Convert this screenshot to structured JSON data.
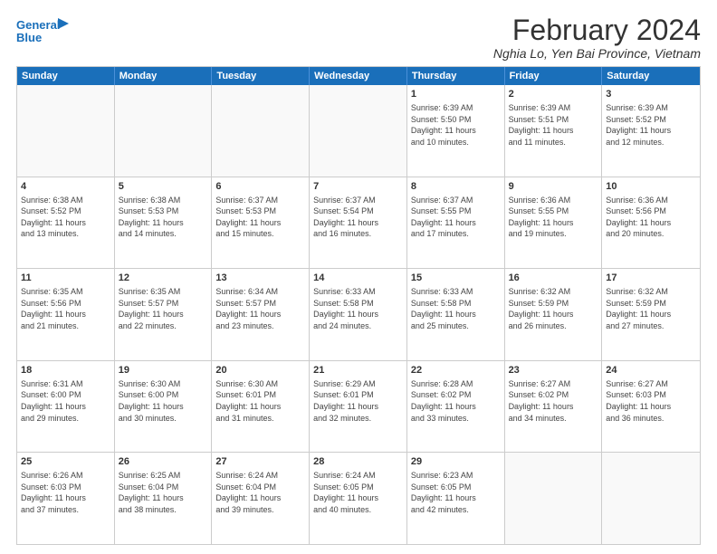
{
  "logo": {
    "line1": "General",
    "line2": "Blue",
    "icon_color": "#1a6fba"
  },
  "title": "February 2024",
  "location": "Nghia Lo, Yen Bai Province, Vietnam",
  "header_days": [
    "Sunday",
    "Monday",
    "Tuesday",
    "Wednesday",
    "Thursday",
    "Friday",
    "Saturday"
  ],
  "rows": [
    [
      {
        "day": "",
        "info": ""
      },
      {
        "day": "",
        "info": ""
      },
      {
        "day": "",
        "info": ""
      },
      {
        "day": "",
        "info": ""
      },
      {
        "day": "1",
        "info": "Sunrise: 6:39 AM\nSunset: 5:50 PM\nDaylight: 11 hours\nand 10 minutes."
      },
      {
        "day": "2",
        "info": "Sunrise: 6:39 AM\nSunset: 5:51 PM\nDaylight: 11 hours\nand 11 minutes."
      },
      {
        "day": "3",
        "info": "Sunrise: 6:39 AM\nSunset: 5:52 PM\nDaylight: 11 hours\nand 12 minutes."
      }
    ],
    [
      {
        "day": "4",
        "info": "Sunrise: 6:38 AM\nSunset: 5:52 PM\nDaylight: 11 hours\nand 13 minutes."
      },
      {
        "day": "5",
        "info": "Sunrise: 6:38 AM\nSunset: 5:53 PM\nDaylight: 11 hours\nand 14 minutes."
      },
      {
        "day": "6",
        "info": "Sunrise: 6:37 AM\nSunset: 5:53 PM\nDaylight: 11 hours\nand 15 minutes."
      },
      {
        "day": "7",
        "info": "Sunrise: 6:37 AM\nSunset: 5:54 PM\nDaylight: 11 hours\nand 16 minutes."
      },
      {
        "day": "8",
        "info": "Sunrise: 6:37 AM\nSunset: 5:55 PM\nDaylight: 11 hours\nand 17 minutes."
      },
      {
        "day": "9",
        "info": "Sunrise: 6:36 AM\nSunset: 5:55 PM\nDaylight: 11 hours\nand 19 minutes."
      },
      {
        "day": "10",
        "info": "Sunrise: 6:36 AM\nSunset: 5:56 PM\nDaylight: 11 hours\nand 20 minutes."
      }
    ],
    [
      {
        "day": "11",
        "info": "Sunrise: 6:35 AM\nSunset: 5:56 PM\nDaylight: 11 hours\nand 21 minutes."
      },
      {
        "day": "12",
        "info": "Sunrise: 6:35 AM\nSunset: 5:57 PM\nDaylight: 11 hours\nand 22 minutes."
      },
      {
        "day": "13",
        "info": "Sunrise: 6:34 AM\nSunset: 5:57 PM\nDaylight: 11 hours\nand 23 minutes."
      },
      {
        "day": "14",
        "info": "Sunrise: 6:33 AM\nSunset: 5:58 PM\nDaylight: 11 hours\nand 24 minutes."
      },
      {
        "day": "15",
        "info": "Sunrise: 6:33 AM\nSunset: 5:58 PM\nDaylight: 11 hours\nand 25 minutes."
      },
      {
        "day": "16",
        "info": "Sunrise: 6:32 AM\nSunset: 5:59 PM\nDaylight: 11 hours\nand 26 minutes."
      },
      {
        "day": "17",
        "info": "Sunrise: 6:32 AM\nSunset: 5:59 PM\nDaylight: 11 hours\nand 27 minutes."
      }
    ],
    [
      {
        "day": "18",
        "info": "Sunrise: 6:31 AM\nSunset: 6:00 PM\nDaylight: 11 hours\nand 29 minutes."
      },
      {
        "day": "19",
        "info": "Sunrise: 6:30 AM\nSunset: 6:00 PM\nDaylight: 11 hours\nand 30 minutes."
      },
      {
        "day": "20",
        "info": "Sunrise: 6:30 AM\nSunset: 6:01 PM\nDaylight: 11 hours\nand 31 minutes."
      },
      {
        "day": "21",
        "info": "Sunrise: 6:29 AM\nSunset: 6:01 PM\nDaylight: 11 hours\nand 32 minutes."
      },
      {
        "day": "22",
        "info": "Sunrise: 6:28 AM\nSunset: 6:02 PM\nDaylight: 11 hours\nand 33 minutes."
      },
      {
        "day": "23",
        "info": "Sunrise: 6:27 AM\nSunset: 6:02 PM\nDaylight: 11 hours\nand 34 minutes."
      },
      {
        "day": "24",
        "info": "Sunrise: 6:27 AM\nSunset: 6:03 PM\nDaylight: 11 hours\nand 36 minutes."
      }
    ],
    [
      {
        "day": "25",
        "info": "Sunrise: 6:26 AM\nSunset: 6:03 PM\nDaylight: 11 hours\nand 37 minutes."
      },
      {
        "day": "26",
        "info": "Sunrise: 6:25 AM\nSunset: 6:04 PM\nDaylight: 11 hours\nand 38 minutes."
      },
      {
        "day": "27",
        "info": "Sunrise: 6:24 AM\nSunset: 6:04 PM\nDaylight: 11 hours\nand 39 minutes."
      },
      {
        "day": "28",
        "info": "Sunrise: 6:24 AM\nSunset: 6:05 PM\nDaylight: 11 hours\nand 40 minutes."
      },
      {
        "day": "29",
        "info": "Sunrise: 6:23 AM\nSunset: 6:05 PM\nDaylight: 11 hours\nand 42 minutes."
      },
      {
        "day": "",
        "info": ""
      },
      {
        "day": "",
        "info": ""
      }
    ]
  ]
}
